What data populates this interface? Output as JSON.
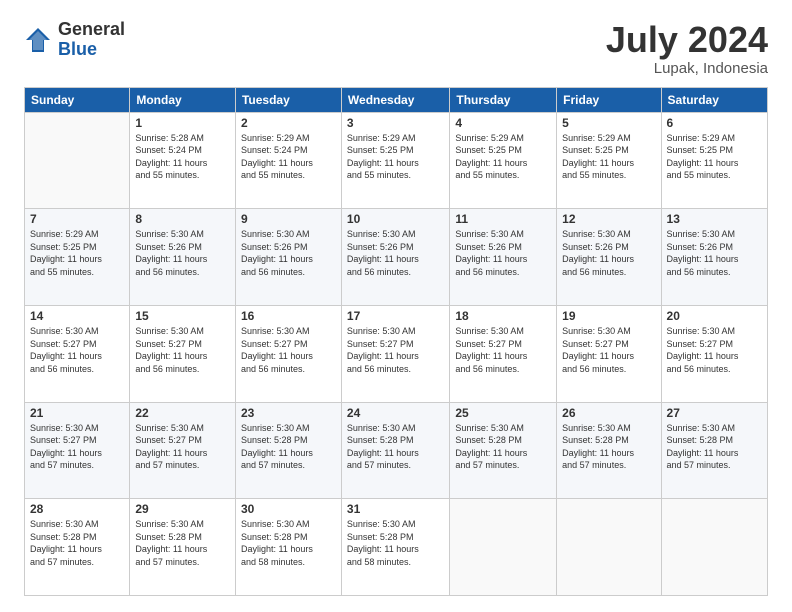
{
  "header": {
    "logo_general": "General",
    "logo_blue": "Blue",
    "month_title": "July 2024",
    "location": "Lupak, Indonesia"
  },
  "weekdays": [
    "Sunday",
    "Monday",
    "Tuesday",
    "Wednesday",
    "Thursday",
    "Friday",
    "Saturday"
  ],
  "weeks": [
    [
      {
        "day": "",
        "info": ""
      },
      {
        "day": "1",
        "info": "Sunrise: 5:28 AM\nSunset: 5:24 PM\nDaylight: 11 hours\nand 55 minutes."
      },
      {
        "day": "2",
        "info": "Sunrise: 5:29 AM\nSunset: 5:24 PM\nDaylight: 11 hours\nand 55 minutes."
      },
      {
        "day": "3",
        "info": "Sunrise: 5:29 AM\nSunset: 5:25 PM\nDaylight: 11 hours\nand 55 minutes."
      },
      {
        "day": "4",
        "info": "Sunrise: 5:29 AM\nSunset: 5:25 PM\nDaylight: 11 hours\nand 55 minutes."
      },
      {
        "day": "5",
        "info": "Sunrise: 5:29 AM\nSunset: 5:25 PM\nDaylight: 11 hours\nand 55 minutes."
      },
      {
        "day": "6",
        "info": "Sunrise: 5:29 AM\nSunset: 5:25 PM\nDaylight: 11 hours\nand 55 minutes."
      }
    ],
    [
      {
        "day": "7",
        "info": "Sunrise: 5:29 AM\nSunset: 5:25 PM\nDaylight: 11 hours\nand 55 minutes."
      },
      {
        "day": "8",
        "info": "Sunrise: 5:30 AM\nSunset: 5:26 PM\nDaylight: 11 hours\nand 56 minutes."
      },
      {
        "day": "9",
        "info": "Sunrise: 5:30 AM\nSunset: 5:26 PM\nDaylight: 11 hours\nand 56 minutes."
      },
      {
        "day": "10",
        "info": "Sunrise: 5:30 AM\nSunset: 5:26 PM\nDaylight: 11 hours\nand 56 minutes."
      },
      {
        "day": "11",
        "info": "Sunrise: 5:30 AM\nSunset: 5:26 PM\nDaylight: 11 hours\nand 56 minutes."
      },
      {
        "day": "12",
        "info": "Sunrise: 5:30 AM\nSunset: 5:26 PM\nDaylight: 11 hours\nand 56 minutes."
      },
      {
        "day": "13",
        "info": "Sunrise: 5:30 AM\nSunset: 5:26 PM\nDaylight: 11 hours\nand 56 minutes."
      }
    ],
    [
      {
        "day": "14",
        "info": "Sunrise: 5:30 AM\nSunset: 5:27 PM\nDaylight: 11 hours\nand 56 minutes."
      },
      {
        "day": "15",
        "info": "Sunrise: 5:30 AM\nSunset: 5:27 PM\nDaylight: 11 hours\nand 56 minutes."
      },
      {
        "day": "16",
        "info": "Sunrise: 5:30 AM\nSunset: 5:27 PM\nDaylight: 11 hours\nand 56 minutes."
      },
      {
        "day": "17",
        "info": "Sunrise: 5:30 AM\nSunset: 5:27 PM\nDaylight: 11 hours\nand 56 minutes."
      },
      {
        "day": "18",
        "info": "Sunrise: 5:30 AM\nSunset: 5:27 PM\nDaylight: 11 hours\nand 56 minutes."
      },
      {
        "day": "19",
        "info": "Sunrise: 5:30 AM\nSunset: 5:27 PM\nDaylight: 11 hours\nand 56 minutes."
      },
      {
        "day": "20",
        "info": "Sunrise: 5:30 AM\nSunset: 5:27 PM\nDaylight: 11 hours\nand 56 minutes."
      }
    ],
    [
      {
        "day": "21",
        "info": "Sunrise: 5:30 AM\nSunset: 5:27 PM\nDaylight: 11 hours\nand 57 minutes."
      },
      {
        "day": "22",
        "info": "Sunrise: 5:30 AM\nSunset: 5:27 PM\nDaylight: 11 hours\nand 57 minutes."
      },
      {
        "day": "23",
        "info": "Sunrise: 5:30 AM\nSunset: 5:28 PM\nDaylight: 11 hours\nand 57 minutes."
      },
      {
        "day": "24",
        "info": "Sunrise: 5:30 AM\nSunset: 5:28 PM\nDaylight: 11 hours\nand 57 minutes."
      },
      {
        "day": "25",
        "info": "Sunrise: 5:30 AM\nSunset: 5:28 PM\nDaylight: 11 hours\nand 57 minutes."
      },
      {
        "day": "26",
        "info": "Sunrise: 5:30 AM\nSunset: 5:28 PM\nDaylight: 11 hours\nand 57 minutes."
      },
      {
        "day": "27",
        "info": "Sunrise: 5:30 AM\nSunset: 5:28 PM\nDaylight: 11 hours\nand 57 minutes."
      }
    ],
    [
      {
        "day": "28",
        "info": "Sunrise: 5:30 AM\nSunset: 5:28 PM\nDaylight: 11 hours\nand 57 minutes."
      },
      {
        "day": "29",
        "info": "Sunrise: 5:30 AM\nSunset: 5:28 PM\nDaylight: 11 hours\nand 57 minutes."
      },
      {
        "day": "30",
        "info": "Sunrise: 5:30 AM\nSunset: 5:28 PM\nDaylight: 11 hours\nand 58 minutes."
      },
      {
        "day": "31",
        "info": "Sunrise: 5:30 AM\nSunset: 5:28 PM\nDaylight: 11 hours\nand 58 minutes."
      },
      {
        "day": "",
        "info": ""
      },
      {
        "day": "",
        "info": ""
      },
      {
        "day": "",
        "info": ""
      }
    ]
  ]
}
